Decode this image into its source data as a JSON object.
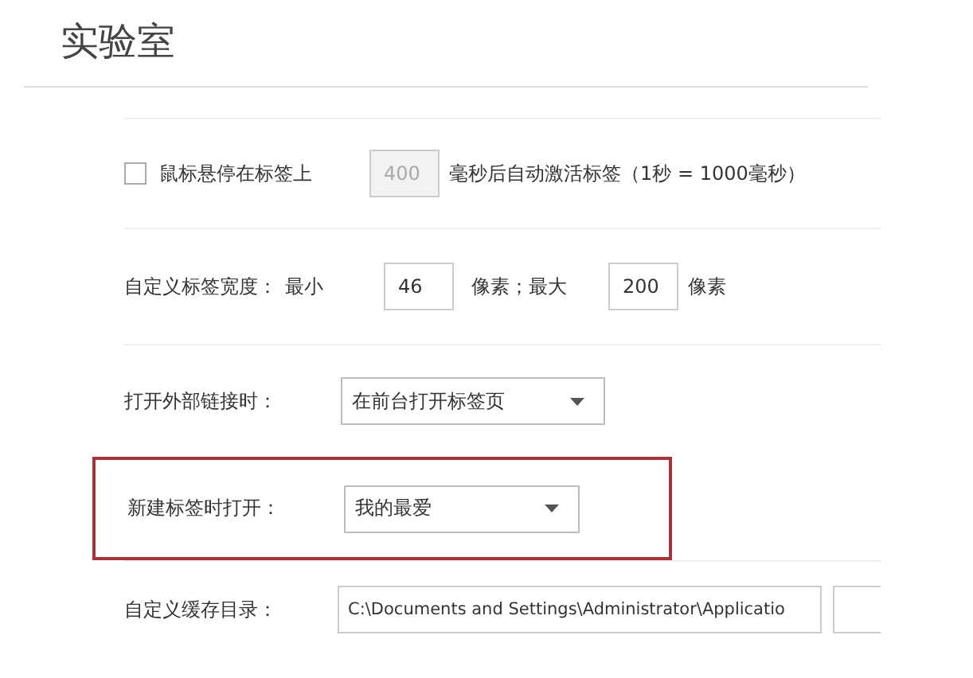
{
  "title": "实验室",
  "hover": {
    "checked": false,
    "label": "鼠标悬停在标签上",
    "value": "400",
    "disabled": true,
    "suffix": "毫秒后自动激活标签（1秒 = 1000毫秒）"
  },
  "tab_width": {
    "label": "自定义标签宽度：",
    "min_label": "最小",
    "min_value": "46",
    "mid_label": "像素；最大",
    "max_value": "200",
    "unit": "像素"
  },
  "external_link": {
    "label": "打开外部链接时：",
    "value": "在前台打开标签页"
  },
  "new_tab": {
    "label": "新建标签时打开：",
    "value": "我的最爱",
    "highlighted": true
  },
  "cache_dir": {
    "label": "自定义缓存目录：",
    "value": "C:\\Documents and Settings\\Administrator\\Applicatio"
  }
}
